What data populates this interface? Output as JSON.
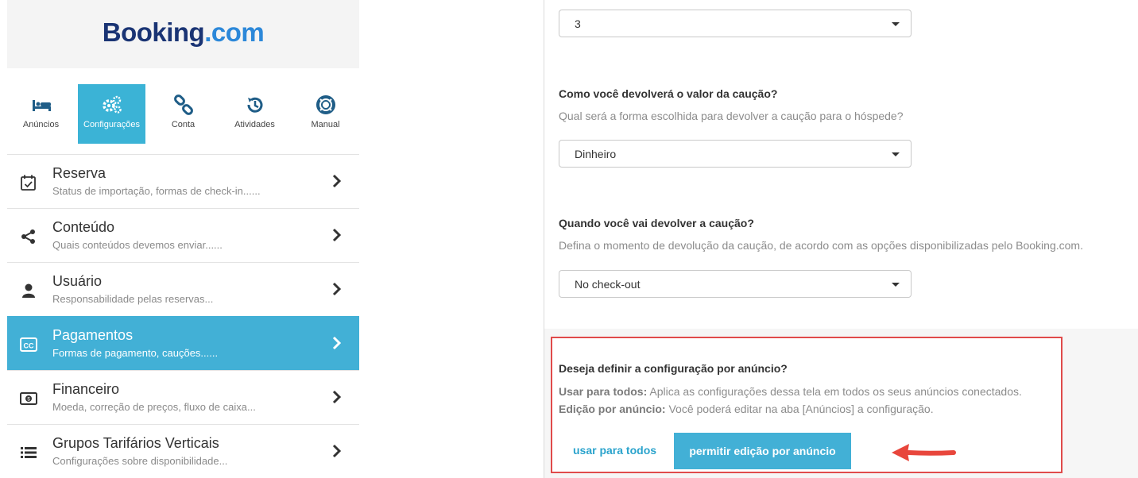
{
  "logo": {
    "brand": "Booking",
    "suffix": ".com"
  },
  "tabs": [
    {
      "label": "Anúncios",
      "icon": "bed-icon"
    },
    {
      "label": "Configurações",
      "icon": "gears-icon"
    },
    {
      "label": "Conta",
      "icon": "link-icon"
    },
    {
      "label": "Atividades",
      "icon": "history-icon"
    },
    {
      "label": "Manual",
      "icon": "lifebuoy-icon"
    }
  ],
  "menu": [
    {
      "title": "Reserva",
      "subtitle": "Status de importação, formas de check-in......",
      "icon": "calendar-check-icon"
    },
    {
      "title": "Conteúdo",
      "subtitle": "Quais conteúdos devemos enviar......",
      "icon": "share-icon"
    },
    {
      "title": "Usuário",
      "subtitle": "Responsabilidade pelas reservas...",
      "icon": "user-icon"
    },
    {
      "title": "Pagamentos",
      "subtitle": "Formas de pagamento, cauções......",
      "icon": "credit-card-icon"
    },
    {
      "title": "Financeiro",
      "subtitle": "Moeda, correção de preços, fluxo de caixa...",
      "icon": "money-icon"
    },
    {
      "title": "Grupos Tarifários Verticais",
      "subtitle": "Configurações sobre disponibilidade...",
      "icon": "list-icon"
    }
  ],
  "form": {
    "top_select_value": "3",
    "q_how": "Como você devolverá o valor da caução?",
    "h_how": "Qual será a forma escolhida para devolver a caução para o hóspede?",
    "select_how": "Dinheiro",
    "q_when": "Quando você vai devolver a caução?",
    "h_when": "Defina o momento de devolução da caução, de acordo com as opções disponibilizadas pelo Booking.com.",
    "select_when": "No check-out"
  },
  "config_card": {
    "question": "Deseja definir a configuração por anúncio?",
    "use_all_label": "Usar para todos:",
    "use_all_text": " Aplica as configurações dessa tela em todos os seus anúncios conectados.",
    "per_ad_label": "Edição por anúncio:",
    "per_ad_text": " Você poderá editar na aba [Anúncios] a configuração.",
    "btn_use_all": "usar para todos",
    "btn_per_ad": "permitir edição por anúncio"
  },
  "colors": {
    "accent": "#42b0d6",
    "highlight_border": "#e04b4b",
    "brand_dark": "#1a3474",
    "brand_light": "#2c88d9"
  }
}
